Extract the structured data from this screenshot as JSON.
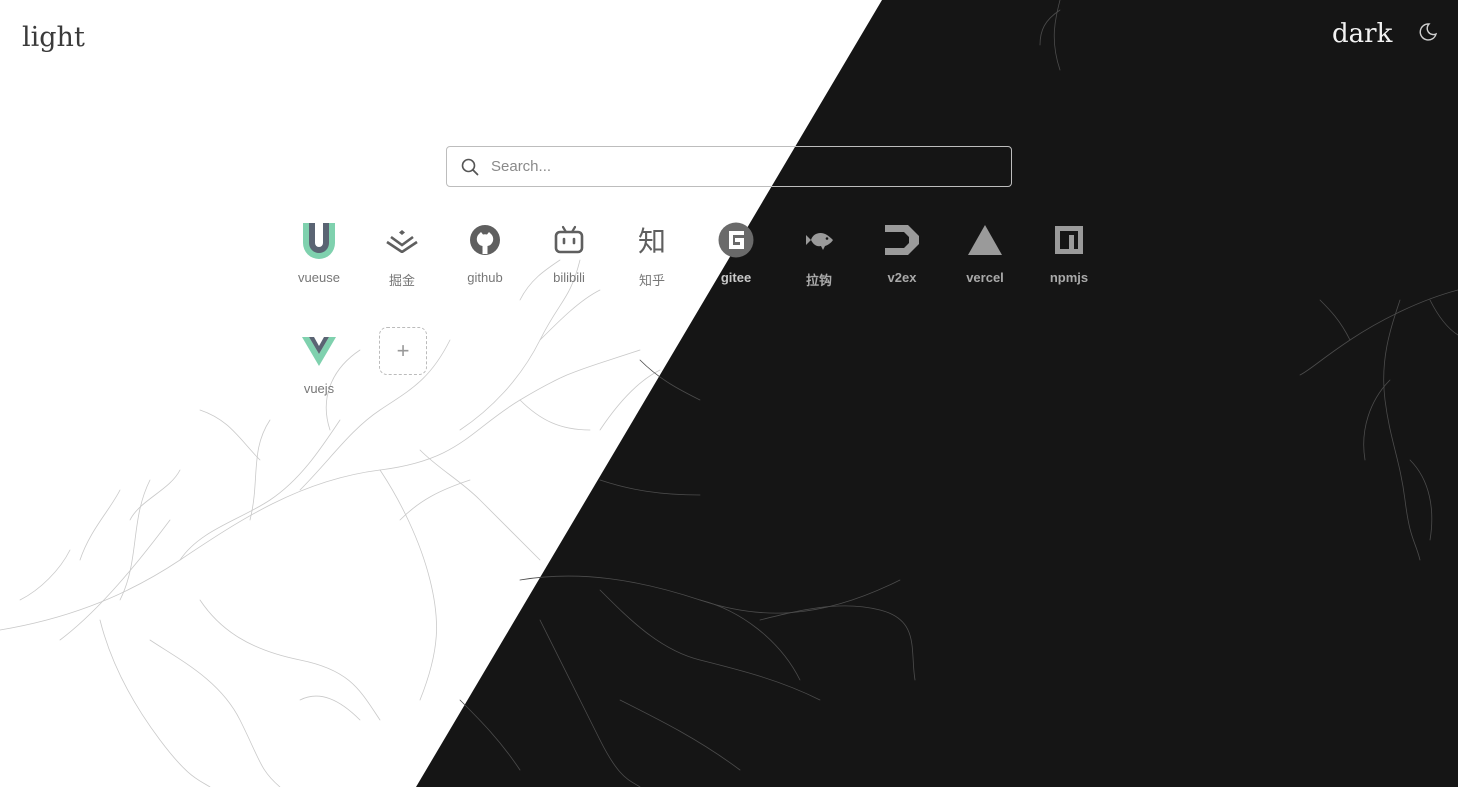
{
  "theme": {
    "light_label": "light",
    "dark_label": "dark",
    "toggle_icon": "moon-icon",
    "light_bg": "#ffffff",
    "dark_bg": "#151515"
  },
  "search": {
    "placeholder": "Search...",
    "value": ""
  },
  "shortcuts": [
    {
      "label": "vueuse",
      "icon": "vueuse-icon",
      "color": "#41b883"
    },
    {
      "label": "掘金",
      "icon": "juejin-icon"
    },
    {
      "label": "github",
      "icon": "github-icon"
    },
    {
      "label": "bilibili",
      "icon": "bilibili-icon"
    },
    {
      "label": "知乎",
      "icon": "zhihu-icon",
      "glyph": "知"
    },
    {
      "label": "gitee",
      "icon": "gitee-icon"
    },
    {
      "label": "拉钩",
      "icon": "lagou-icon"
    },
    {
      "label": "v2ex",
      "icon": "v2ex-icon"
    },
    {
      "label": "vercel",
      "icon": "vercel-icon"
    },
    {
      "label": "npmjs",
      "icon": "npm-icon"
    },
    {
      "label": "vuejs",
      "icon": "vue-icon",
      "color": "#41b883"
    }
  ],
  "add_shortcut": {
    "label": "+",
    "icon": "plus-icon"
  }
}
